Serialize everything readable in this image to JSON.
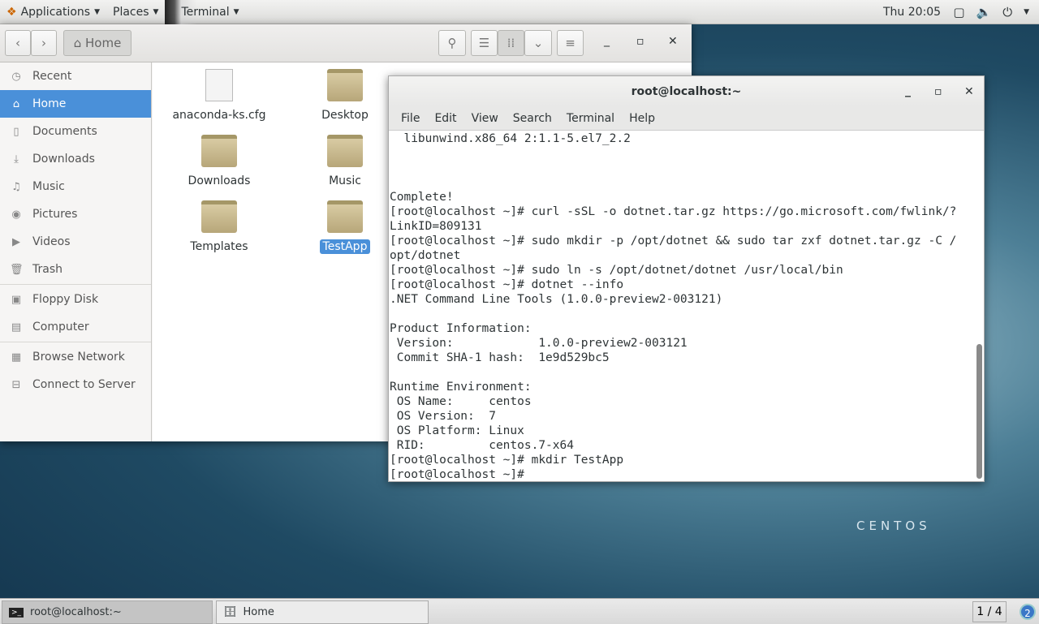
{
  "topbar": {
    "applications": "Applications",
    "places": "Places",
    "terminal": "Terminal",
    "clock": "Thu 20:05"
  },
  "files": {
    "location": "Home",
    "sidebar": [
      {
        "label": "Recent",
        "icon": "clock-icon"
      },
      {
        "label": "Home",
        "icon": "home-icon",
        "active": true
      },
      {
        "label": "Documents",
        "icon": "document-icon"
      },
      {
        "label": "Downloads",
        "icon": "download-icon"
      },
      {
        "label": "Music",
        "icon": "music-icon"
      },
      {
        "label": "Pictures",
        "icon": "camera-icon"
      },
      {
        "label": "Videos",
        "icon": "video-icon"
      },
      {
        "label": "Trash",
        "icon": "trash-icon"
      },
      {
        "label": "Floppy Disk",
        "icon": "floppy-icon"
      },
      {
        "label": "Computer",
        "icon": "computer-icon"
      },
      {
        "label": "Browse Network",
        "icon": "network-icon"
      },
      {
        "label": "Connect to Server",
        "icon": "server-icon"
      }
    ],
    "items": [
      "anaconda-ks.cfg",
      "Desktop",
      "Downloads",
      "Music",
      "Templates",
      "TestApp"
    ]
  },
  "terminal": {
    "title": "root@localhost:~",
    "menu": [
      "File",
      "Edit",
      "View",
      "Search",
      "Terminal",
      "Help"
    ],
    "lines": [
      "  libunwind.x86_64 2:1.1-5.el7_2.2",
      "",
      "",
      "",
      "Complete!",
      "[root@localhost ~]# curl -sSL -o dotnet.tar.gz https://go.microsoft.com/fwlink/?",
      "LinkID=809131",
      "[root@localhost ~]# sudo mkdir -p /opt/dotnet && sudo tar zxf dotnet.tar.gz -C /",
      "opt/dotnet",
      "[root@localhost ~]# sudo ln -s /opt/dotnet/dotnet /usr/local/bin",
      "[root@localhost ~]# dotnet --info",
      ".NET Command Line Tools (1.0.0-preview2-003121)",
      "",
      "Product Information:",
      " Version:            1.0.0-preview2-003121",
      " Commit SHA-1 hash:  1e9d529bc5",
      "",
      "Runtime Environment:",
      " OS Name:     centos",
      " OS Version:  7",
      " OS Platform: Linux",
      " RID:         centos.7-x64",
      "[root@localhost ~]# mkdir TestApp",
      "[root@localhost ~]#"
    ]
  },
  "desktop": {
    "logo_text": "CENTOS"
  },
  "taskbar": {
    "tasks": [
      "root@localhost:~",
      "Home"
    ],
    "workspace": "1 / 4",
    "notifications": "2"
  }
}
